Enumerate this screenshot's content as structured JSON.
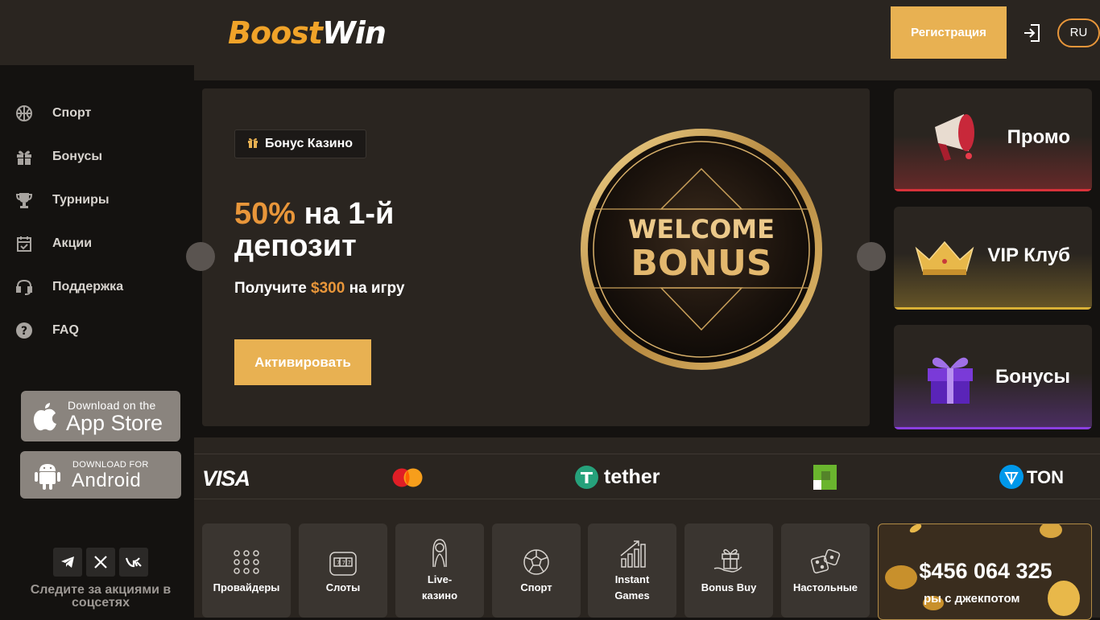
{
  "header": {
    "logo_part1": "Boost",
    "logo_part2": "Win",
    "register_label": "Регистрация",
    "lang_label": "RU"
  },
  "sidebar": {
    "items": [
      {
        "label": "Спорт",
        "icon": "basketball-icon"
      },
      {
        "label": "Бонусы",
        "icon": "gift-icon"
      },
      {
        "label": "Турниры",
        "icon": "trophy-icon"
      },
      {
        "label": "Акции",
        "icon": "calendar-check-icon"
      },
      {
        "label": "Поддержка",
        "icon": "headset-icon"
      },
      {
        "label": "FAQ",
        "icon": "question-icon"
      }
    ],
    "appstore": {
      "small": "Download on the",
      "big": "App Store"
    },
    "android": {
      "small": "DOWNLOAD FOR",
      "big": "Android"
    },
    "social": [
      "telegram-icon",
      "x-icon",
      "vk-icon"
    ],
    "follow_text": "Следите за акциями в соцсетях"
  },
  "banner": {
    "badge": "Бонус Казино",
    "title_highlight": "50%",
    "title_rest": " на 1-й депозит",
    "sub_prefix": "Получите ",
    "sub_amount": "$300",
    "sub_suffix": " на игру",
    "activate_label": "Активировать",
    "coin_line1": "WELCOME",
    "coin_line2": "BONUS"
  },
  "promo_cards": [
    {
      "label": "Промо",
      "icon": "megaphone-icon",
      "accent": "#d8323a"
    },
    {
      "label": "VIP Клуб",
      "icon": "crown-icon",
      "accent": "#d8b035"
    },
    {
      "label": "Бонусы",
      "icon": "gift-box-icon",
      "accent": "#8a3fe0"
    }
  ],
  "payments": {
    "visa": "VISA",
    "tether": "tether",
    "ton": "TON"
  },
  "categories": [
    {
      "label": "Провайдеры",
      "icon": "dots-grid-icon"
    },
    {
      "label": "Слоты",
      "icon": "slot-machine-icon"
    },
    {
      "label": "Live-казино",
      "icon": "dealer-icon"
    },
    {
      "label": "Спорт",
      "icon": "soccer-ball-icon"
    },
    {
      "label": "Instant Games",
      "icon": "chart-up-icon"
    },
    {
      "label": "Bonus Buy",
      "icon": "gift-hand-icon"
    },
    {
      "label": "Настольные",
      "icon": "dice-icon"
    }
  ],
  "jackpot": {
    "amount": "$456 064 325",
    "label": "ры с джекпотом"
  },
  "colors": {
    "accent": "#e8b152",
    "orange": "#e8963a",
    "panel": "#2a2520",
    "background": "#141210"
  }
}
